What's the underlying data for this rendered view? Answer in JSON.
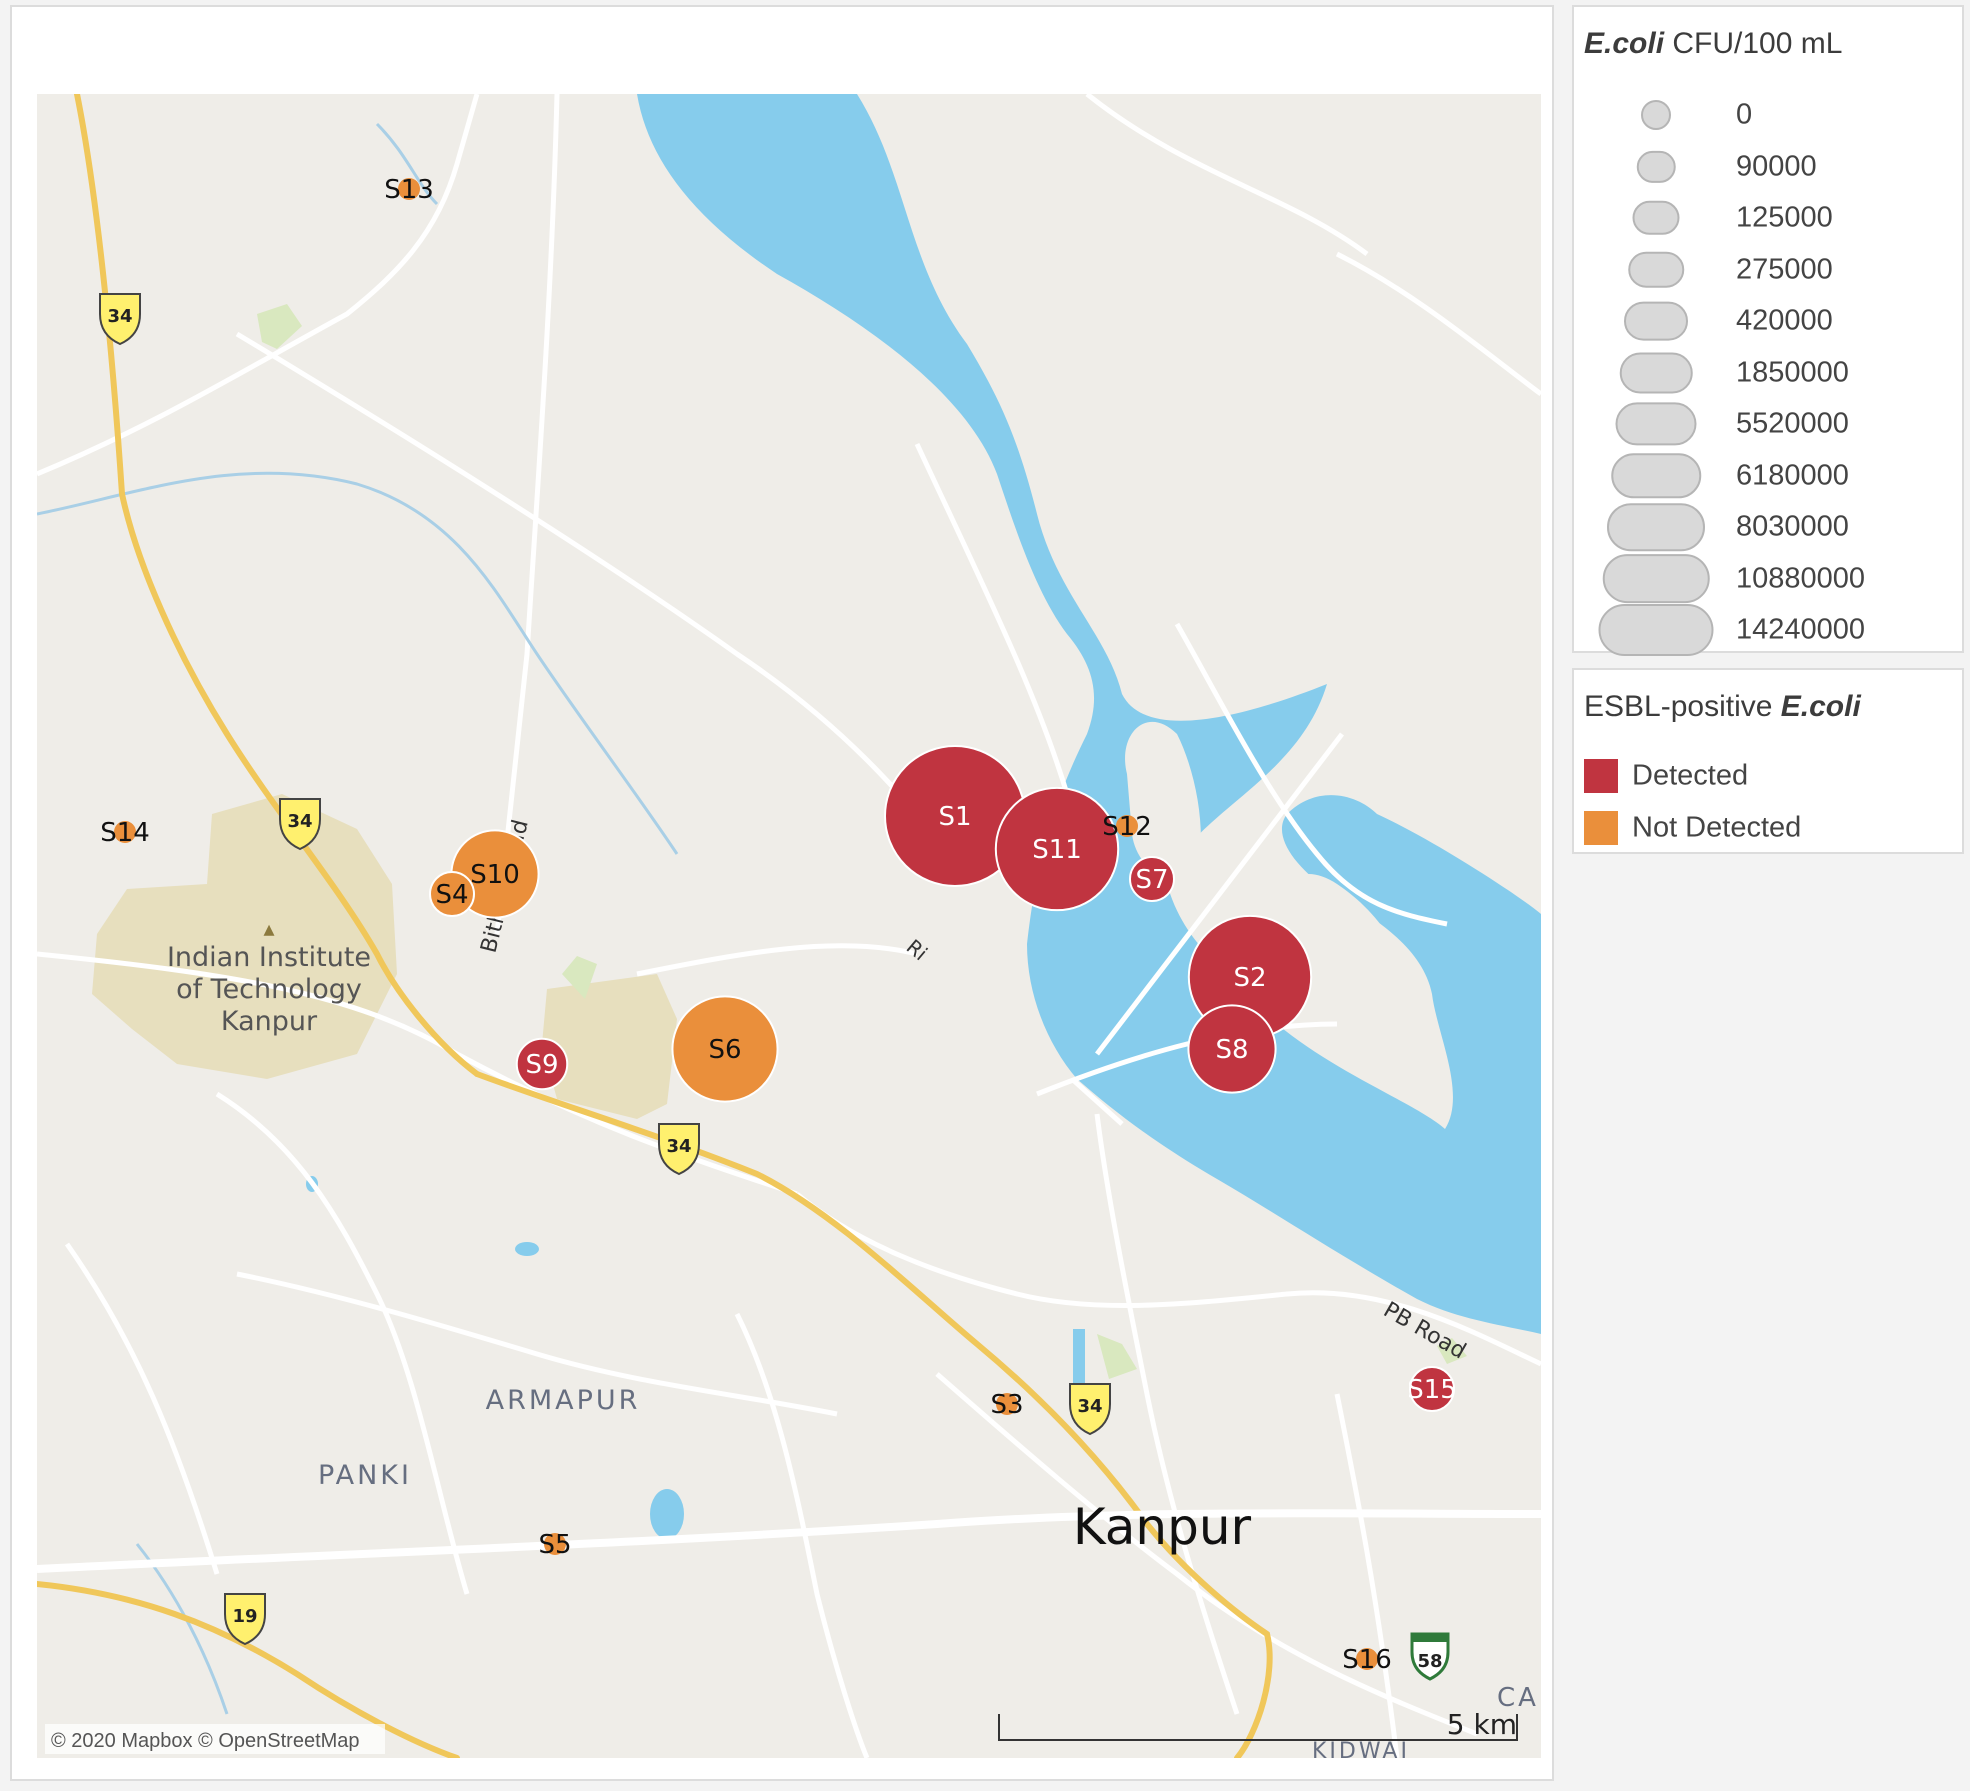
{
  "map": {
    "attribution": "© 2020 Mapbox © OpenStreetMap",
    "scale_label": "5 km",
    "colors": {
      "land": "#efede8",
      "water": "#86ccec",
      "road_major": "#f0c75a",
      "road_minor": "#ffffff",
      "park": "#d9e8bf",
      "campus": "#e7dfbe",
      "detected": "#c03440",
      "not_detected": "#ea8f3b"
    },
    "places": {
      "iit_line1": "Indian Institute",
      "iit_line2": "of Technology",
      "iit_line3": "Kanpur",
      "armapur": "ARMAPUR",
      "panki": "PANKI",
      "kanpur": "Kanpur",
      "bithoor_road": "Bithoor road",
      "pb_road": "PB Road",
      "cant_partial": "CAI",
      "kidwai_partial": "KIDWAI",
      "river_partial": "Ri"
    },
    "highway_shields": [
      "34",
      "34",
      "34",
      "34",
      "19",
      "58"
    ],
    "sites": [
      {
        "label": "S1",
        "ecoli": 14240000,
        "esbl": "Detected"
      },
      {
        "label": "S2",
        "ecoli": 10880000,
        "esbl": "Detected"
      },
      {
        "label": "S3",
        "ecoli": 0,
        "esbl": "Not Detected"
      },
      {
        "label": "S4",
        "ecoli": 420000,
        "esbl": "Not Detected"
      },
      {
        "label": "S5",
        "ecoli": 0,
        "esbl": "Not Detected"
      },
      {
        "label": "S6",
        "ecoli": 8030000,
        "esbl": "Not Detected"
      },
      {
        "label": "S7",
        "ecoli": 125000,
        "esbl": "Detected"
      },
      {
        "label": "S8",
        "ecoli": 5520000,
        "esbl": "Detected"
      },
      {
        "label": "S9",
        "ecoli": 1850000,
        "esbl": "Detected"
      },
      {
        "label": "S10",
        "ecoli": 5520000,
        "esbl": "Not Detected"
      },
      {
        "label": "S11",
        "ecoli": 10880000,
        "esbl": "Detected"
      },
      {
        "label": "S12",
        "ecoli": 0,
        "esbl": "Not Detected"
      },
      {
        "label": "S13",
        "ecoli": 0,
        "esbl": "Not Detected"
      },
      {
        "label": "S14",
        "ecoli": 0,
        "esbl": "Not Detected"
      },
      {
        "label": "S15",
        "ecoli": 275000,
        "esbl": "Detected"
      },
      {
        "label": "S16",
        "ecoli": 0,
        "esbl": "Not Detected"
      }
    ]
  },
  "size_legend": {
    "title_italic": "E.coli",
    "title_rest": "CFU/100 mL",
    "values": [
      "0",
      "90000",
      "125000",
      "275000",
      "420000",
      "1850000",
      "5520000",
      "6180000",
      "8030000",
      "10880000",
      "14240000"
    ]
  },
  "color_legend": {
    "title_plain": "ESBL-positive",
    "title_italic": "E.coli",
    "items": [
      {
        "label": "Detected",
        "color": "#c03440"
      },
      {
        "label": "Not Detected",
        "color": "#ea8f3b"
      }
    ]
  }
}
